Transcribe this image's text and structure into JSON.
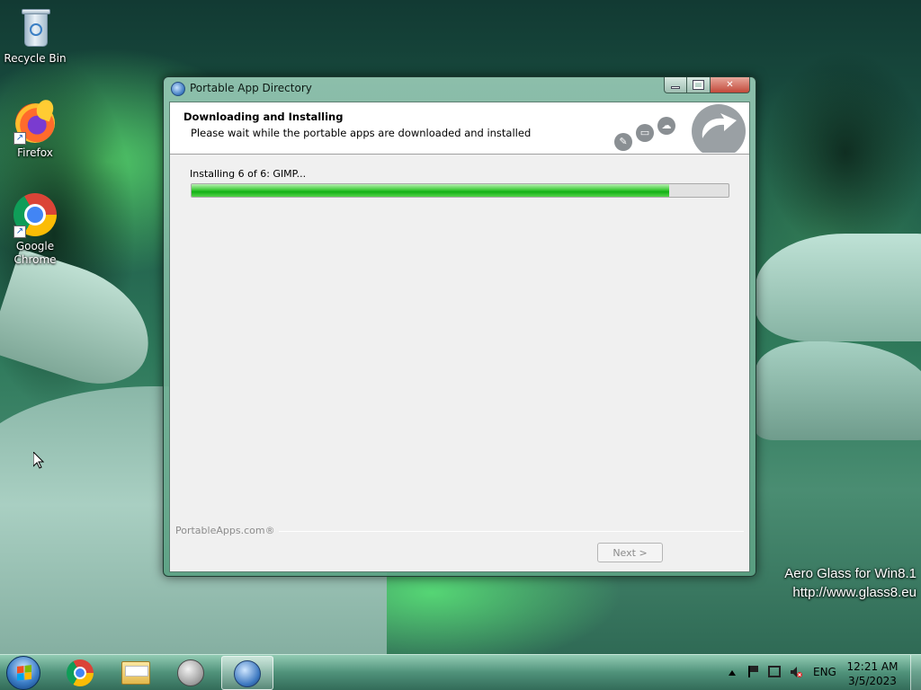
{
  "desktop": {
    "icons": [
      {
        "label": "Recycle Bin",
        "icon": "recycle-bin-icon"
      },
      {
        "label": "Firefox",
        "icon": "firefox-icon"
      },
      {
        "label": "Google Chrome",
        "icon": "chrome-icon"
      }
    ],
    "watermark": {
      "line1": "Aero Glass for Win8.1",
      "line2": "http://www.glass8.eu"
    }
  },
  "window": {
    "title": "Portable App Directory",
    "header": {
      "title": "Downloading and Installing",
      "subtitle": "Please wait while the portable apps are downloaded and installed"
    },
    "status": "Installing 6 of 6: GIMP...",
    "progress_fraction": 0.89,
    "brand": "PortableApps.com®",
    "next_label": "Next >",
    "next_enabled": false
  },
  "taskbar": {
    "items": [
      {
        "name": "taskbar-chrome",
        "icon": "chrome-icon",
        "active": false
      },
      {
        "name": "taskbar-file-explorer",
        "icon": "folder-icon",
        "active": false
      },
      {
        "name": "taskbar-portableapps",
        "icon": "portableapps-icon",
        "active": false
      },
      {
        "name": "taskbar-portable-app-directory",
        "icon": "globe-icon",
        "active": true
      }
    ],
    "tray": {
      "language": "ENG",
      "time": "12:21 AM",
      "date": "3/5/2023"
    }
  },
  "colors": {
    "progress_green": "#12b014",
    "glass_green": "#5a9f82"
  }
}
